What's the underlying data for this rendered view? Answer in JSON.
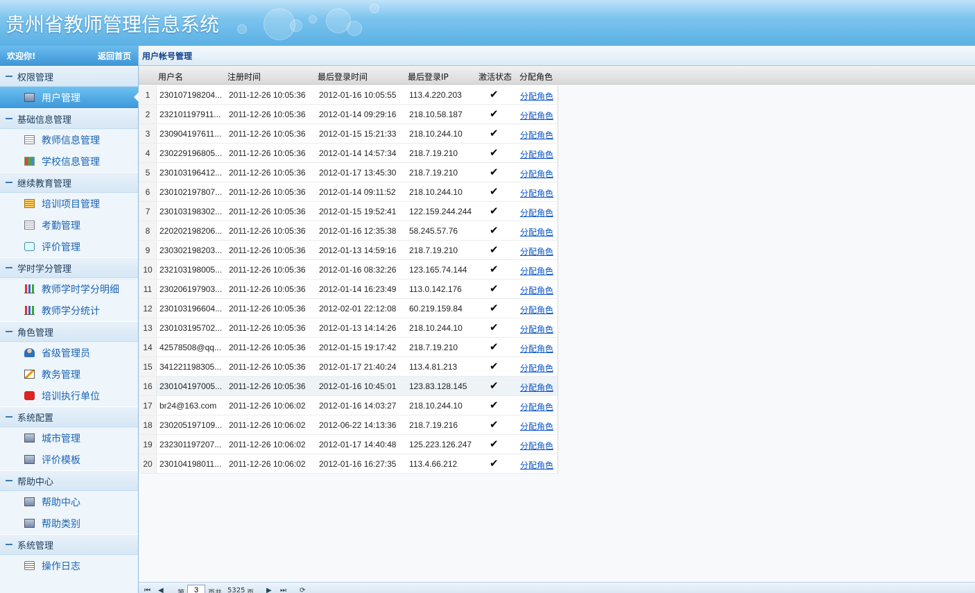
{
  "header": {
    "title": "贵州省教师管理信息系统"
  },
  "sidebar": {
    "welcome": "欢迎你!",
    "home_link": "返回首页",
    "groups": [
      {
        "label": "权限管理",
        "items": [
          {
            "label": "用户管理",
            "icon": "monitor-icon",
            "active": true
          }
        ]
      },
      {
        "label": "基础信息管理",
        "items": [
          {
            "label": "教师信息管理",
            "icon": "document-icon"
          },
          {
            "label": "学校信息管理",
            "icon": "grid-icon"
          }
        ]
      },
      {
        "label": "继续教育管理",
        "items": [
          {
            "label": "培训项目管理",
            "icon": "book-icon"
          },
          {
            "label": "考勤管理",
            "icon": "document-icon"
          },
          {
            "label": "评价管理",
            "icon": "chat-icon"
          }
        ]
      },
      {
        "label": "学时学分管理",
        "items": [
          {
            "label": "教师学时学分明细",
            "icon": "bar-chart-icon"
          },
          {
            "label": "教师学分统计",
            "icon": "bar-chart-icon"
          }
        ]
      },
      {
        "label": "角色管理",
        "items": [
          {
            "label": "省级管理员",
            "icon": "user-icon"
          },
          {
            "label": "教务管理",
            "icon": "pencil-icon"
          },
          {
            "label": "培训执行单位",
            "icon": "red-badge-icon"
          }
        ]
      },
      {
        "label": "系统配置",
        "items": [
          {
            "label": "城市管理",
            "icon": "monitor-icon"
          },
          {
            "label": "评价模板",
            "icon": "monitor-icon"
          }
        ]
      },
      {
        "label": "帮助中心",
        "items": [
          {
            "label": "帮助中心",
            "icon": "monitor-icon"
          },
          {
            "label": "帮助类别",
            "icon": "monitor-icon"
          }
        ]
      },
      {
        "label": "系统管理",
        "items": [
          {
            "label": "操作日志",
            "icon": "list-icon"
          }
        ]
      }
    ]
  },
  "main": {
    "panel_title": "用户帐号管理",
    "columns": [
      "用户名",
      "注册时间",
      "最后登录时间",
      "最后登录IP",
      "激活状态",
      "分配角色"
    ],
    "rows": [
      [
        "1",
        "230107198204...",
        "2011-12-26 10:05:36",
        "2012-01-16 10:05:55",
        "113.4.220.203",
        "✔",
        "分配角色"
      ],
      [
        "2",
        "232101197911...",
        "2011-12-26 10:05:36",
        "2012-01-14 09:29:16",
        "218.10.58.187",
        "✔",
        "分配角色"
      ],
      [
        "3",
        "230904197611...",
        "2011-12-26 10:05:36",
        "2012-01-15 15:21:33",
        "218.10.244.10",
        "✔",
        "分配角色"
      ],
      [
        "4",
        "230229196805...",
        "2011-12-26 10:05:36",
        "2012-01-14 14:57:34",
        "218.7.19.210",
        "✔",
        "分配角色"
      ],
      [
        "5",
        "230103196412...",
        "2011-12-26 10:05:36",
        "2012-01-17 13:45:30",
        "218.7.19.210",
        "✔",
        "分配角色"
      ],
      [
        "6",
        "230102197807...",
        "2011-12-26 10:05:36",
        "2012-01-14 09:11:52",
        "218.10.244.10",
        "✔",
        "分配角色"
      ],
      [
        "7",
        "230103198302...",
        "2011-12-26 10:05:36",
        "2012-01-15 19:52:41",
        "122.159.244.244",
        "✔",
        "分配角色"
      ],
      [
        "8",
        "220202198206...",
        "2011-12-26 10:05:36",
        "2012-01-16 12:35:38",
        "58.245.57.76",
        "✔",
        "分配角色"
      ],
      [
        "9",
        "230302198203...",
        "2011-12-26 10:05:36",
        "2012-01-13 14:59:16",
        "218.7.19.210",
        "✔",
        "分配角色"
      ],
      [
        "10",
        "232103198005...",
        "2011-12-26 10:05:36",
        "2012-01-16 08:32:26",
        "123.165.74.144",
        "✔",
        "分配角色"
      ],
      [
        "11",
        "230206197903...",
        "2011-12-26 10:05:36",
        "2012-01-14 16:23:49",
        "113.0.142.176",
        "✔",
        "分配角色"
      ],
      [
        "12",
        "230103196604...",
        "2011-12-26 10:05:36",
        "2012-02-01 22:12:08",
        "60.219.159.84",
        "✔",
        "分配角色"
      ],
      [
        "13",
        "230103195702...",
        "2011-12-26 10:05:36",
        "2012-01-13 14:14:26",
        "218.10.244.10",
        "✔",
        "分配角色"
      ],
      [
        "14",
        "42578508@qq...",
        "2011-12-26 10:05:36",
        "2012-01-15 19:17:42",
        "218.7.19.210",
        "✔",
        "分配角色"
      ],
      [
        "15",
        "341221198305...",
        "2011-12-26 10:05:36",
        "2012-01-17 21:40:24",
        "113.4.81.213",
        "✔",
        "分配角色"
      ],
      [
        "16",
        "230104197005...",
        "2011-12-26 10:05:36",
        "2012-01-16 10:45:01",
        "123.83.128.145",
        "✔",
        "分配角色"
      ],
      [
        "17",
        "br24@163.com",
        "2011-12-26 10:06:02",
        "2012-01-16 14:03:27",
        "218.10.244.10",
        "✔",
        "分配角色"
      ],
      [
        "18",
        "230205197109...",
        "2011-12-26 10:06:02",
        "2012-06-22 14:13:36",
        "218.7.19.216",
        "✔",
        "分配角色"
      ],
      [
        "19",
        "232301197207...",
        "2011-12-26 10:06:02",
        "2012-01-17 14:40:48",
        "125.223.126.247",
        "✔",
        "分配角色"
      ],
      [
        "20",
        "230104198011...",
        "2011-12-26 10:06:02",
        "2012-01-16 16:27:35",
        "113.4.66.212",
        "✔",
        "分配角色"
      ]
    ],
    "highlighted_row": 16
  },
  "pager": {
    "page_prefix": "第",
    "page_value": "3",
    "page_suffix": "页共",
    "total_pages": "5325",
    "total_suffix": "页"
  },
  "colors": {
    "accent": "#3d95d6",
    "link": "#0a55c8",
    "header_bg": "#5ab0e4"
  }
}
